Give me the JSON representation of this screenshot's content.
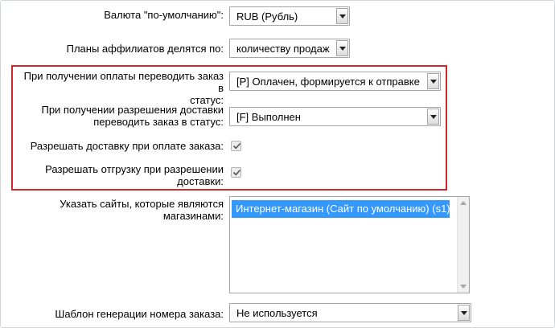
{
  "currency": {
    "label": "Валюта \"по-умолчанию\":",
    "value": "RUB (Рубль)"
  },
  "affiliate_plans": {
    "label": "Планы аффилиатов делятся по:",
    "value": "количеству продаж"
  },
  "payment_status": {
    "label_line1": "При получении оплаты переводить заказ в",
    "label_line2": "статус:",
    "value": "[P] Оплачен, формируется к отправке"
  },
  "delivery_status": {
    "label_line1": "При получении разрешения доставки",
    "label_line2": "переводить заказ в статус:",
    "value": "[F] Выполнен"
  },
  "allow_delivery_on_payment": {
    "label": "Разрешать доставку при оплате заказа:",
    "checked": true
  },
  "allow_shipment_on_delivery": {
    "label_line1": "Разрешать отгрузку при разрешении",
    "label_line2": "доставки:",
    "checked": true
  },
  "shop_sites": {
    "label_line1": "Указать сайты, которые являются",
    "label_line2": "магазинами:",
    "items": [
      "Интернет-магазин (Сайт по умолчанию) (s1)"
    ]
  },
  "order_number_template": {
    "label": "Шаблон генерации номера заказа:",
    "value": "Не используется"
  },
  "colors": {
    "highlight_border": "#d0262d",
    "selected_item": "#3399ff"
  }
}
